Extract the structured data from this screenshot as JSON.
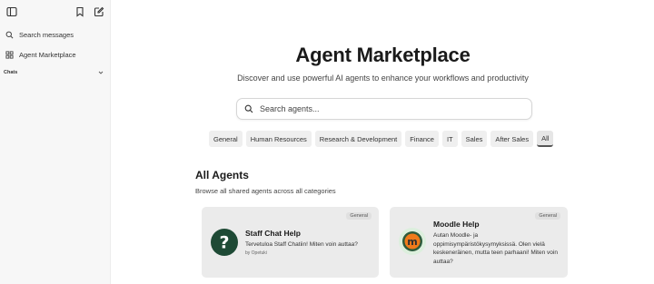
{
  "sidebar": {
    "search_label": "Search messages",
    "marketplace_label": "Agent Marketplace",
    "chats_label": "Chats"
  },
  "main": {
    "title": "Agent Marketplace",
    "subtitle": "Discover and use powerful AI agents to enhance your workflows and productivity",
    "search_placeholder": "Search agents...",
    "tabs": [
      {
        "label": "General"
      },
      {
        "label": "Human Resources"
      },
      {
        "label": "Research & Development"
      },
      {
        "label": "Finance"
      },
      {
        "label": "IT"
      },
      {
        "label": "Sales"
      },
      {
        "label": "After Sales"
      },
      {
        "label": "All",
        "active": true
      }
    ],
    "section_title": "All Agents",
    "section_subtitle": "Browse all shared agents across all categories",
    "cards": [
      {
        "name": "Staff Chat Help",
        "badge": "General",
        "description": "Tervetuloa Staff Chatiin! Miten voin auttaa?",
        "author": "by Opetuki"
      },
      {
        "name": "Moodle Help",
        "badge": "General",
        "description": "Autan Moodle- ja oppimisympäristökysymyksissä. Olen vielä keskeneräinen, mutta teen parhaani! Miten voin auttaa?"
      }
    ]
  },
  "colors": {
    "sidebar_bg": "#f7f7f7",
    "card_bg": "#ebebeb",
    "staff_avatar": "#1e4a35",
    "moodle_orange": "#f07a1a"
  }
}
